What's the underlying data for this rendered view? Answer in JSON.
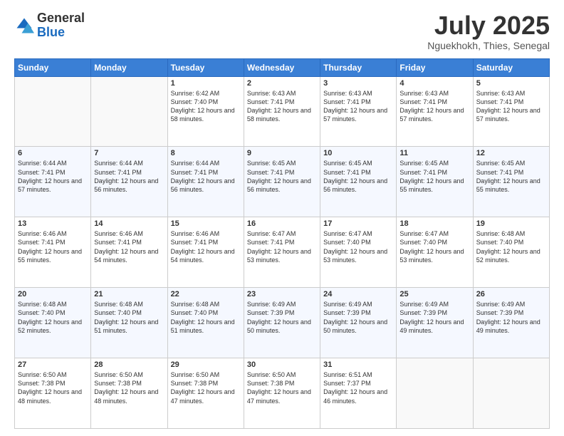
{
  "logo": {
    "general": "General",
    "blue": "Blue"
  },
  "title": "July 2025",
  "subtitle": "Nguekhokh, Thies, Senegal",
  "days_of_week": [
    "Sunday",
    "Monday",
    "Tuesday",
    "Wednesday",
    "Thursday",
    "Friday",
    "Saturday"
  ],
  "weeks": [
    [
      {
        "day": "",
        "info": ""
      },
      {
        "day": "",
        "info": ""
      },
      {
        "day": "1",
        "info": "Sunrise: 6:42 AM\nSunset: 7:40 PM\nDaylight: 12 hours and 58 minutes."
      },
      {
        "day": "2",
        "info": "Sunrise: 6:43 AM\nSunset: 7:41 PM\nDaylight: 12 hours and 58 minutes."
      },
      {
        "day": "3",
        "info": "Sunrise: 6:43 AM\nSunset: 7:41 PM\nDaylight: 12 hours and 57 minutes."
      },
      {
        "day": "4",
        "info": "Sunrise: 6:43 AM\nSunset: 7:41 PM\nDaylight: 12 hours and 57 minutes."
      },
      {
        "day": "5",
        "info": "Sunrise: 6:43 AM\nSunset: 7:41 PM\nDaylight: 12 hours and 57 minutes."
      }
    ],
    [
      {
        "day": "6",
        "info": "Sunrise: 6:44 AM\nSunset: 7:41 PM\nDaylight: 12 hours and 57 minutes."
      },
      {
        "day": "7",
        "info": "Sunrise: 6:44 AM\nSunset: 7:41 PM\nDaylight: 12 hours and 56 minutes."
      },
      {
        "day": "8",
        "info": "Sunrise: 6:44 AM\nSunset: 7:41 PM\nDaylight: 12 hours and 56 minutes."
      },
      {
        "day": "9",
        "info": "Sunrise: 6:45 AM\nSunset: 7:41 PM\nDaylight: 12 hours and 56 minutes."
      },
      {
        "day": "10",
        "info": "Sunrise: 6:45 AM\nSunset: 7:41 PM\nDaylight: 12 hours and 56 minutes."
      },
      {
        "day": "11",
        "info": "Sunrise: 6:45 AM\nSunset: 7:41 PM\nDaylight: 12 hours and 55 minutes."
      },
      {
        "day": "12",
        "info": "Sunrise: 6:45 AM\nSunset: 7:41 PM\nDaylight: 12 hours and 55 minutes."
      }
    ],
    [
      {
        "day": "13",
        "info": "Sunrise: 6:46 AM\nSunset: 7:41 PM\nDaylight: 12 hours and 55 minutes."
      },
      {
        "day": "14",
        "info": "Sunrise: 6:46 AM\nSunset: 7:41 PM\nDaylight: 12 hours and 54 minutes."
      },
      {
        "day": "15",
        "info": "Sunrise: 6:46 AM\nSunset: 7:41 PM\nDaylight: 12 hours and 54 minutes."
      },
      {
        "day": "16",
        "info": "Sunrise: 6:47 AM\nSunset: 7:41 PM\nDaylight: 12 hours and 53 minutes."
      },
      {
        "day": "17",
        "info": "Sunrise: 6:47 AM\nSunset: 7:40 PM\nDaylight: 12 hours and 53 minutes."
      },
      {
        "day": "18",
        "info": "Sunrise: 6:47 AM\nSunset: 7:40 PM\nDaylight: 12 hours and 53 minutes."
      },
      {
        "day": "19",
        "info": "Sunrise: 6:48 AM\nSunset: 7:40 PM\nDaylight: 12 hours and 52 minutes."
      }
    ],
    [
      {
        "day": "20",
        "info": "Sunrise: 6:48 AM\nSunset: 7:40 PM\nDaylight: 12 hours and 52 minutes."
      },
      {
        "day": "21",
        "info": "Sunrise: 6:48 AM\nSunset: 7:40 PM\nDaylight: 12 hours and 51 minutes."
      },
      {
        "day": "22",
        "info": "Sunrise: 6:48 AM\nSunset: 7:40 PM\nDaylight: 12 hours and 51 minutes."
      },
      {
        "day": "23",
        "info": "Sunrise: 6:49 AM\nSunset: 7:39 PM\nDaylight: 12 hours and 50 minutes."
      },
      {
        "day": "24",
        "info": "Sunrise: 6:49 AM\nSunset: 7:39 PM\nDaylight: 12 hours and 50 minutes."
      },
      {
        "day": "25",
        "info": "Sunrise: 6:49 AM\nSunset: 7:39 PM\nDaylight: 12 hours and 49 minutes."
      },
      {
        "day": "26",
        "info": "Sunrise: 6:49 AM\nSunset: 7:39 PM\nDaylight: 12 hours and 49 minutes."
      }
    ],
    [
      {
        "day": "27",
        "info": "Sunrise: 6:50 AM\nSunset: 7:38 PM\nDaylight: 12 hours and 48 minutes."
      },
      {
        "day": "28",
        "info": "Sunrise: 6:50 AM\nSunset: 7:38 PM\nDaylight: 12 hours and 48 minutes."
      },
      {
        "day": "29",
        "info": "Sunrise: 6:50 AM\nSunset: 7:38 PM\nDaylight: 12 hours and 47 minutes."
      },
      {
        "day": "30",
        "info": "Sunrise: 6:50 AM\nSunset: 7:38 PM\nDaylight: 12 hours and 47 minutes."
      },
      {
        "day": "31",
        "info": "Sunrise: 6:51 AM\nSunset: 7:37 PM\nDaylight: 12 hours and 46 minutes."
      },
      {
        "day": "",
        "info": ""
      },
      {
        "day": "",
        "info": ""
      }
    ]
  ]
}
